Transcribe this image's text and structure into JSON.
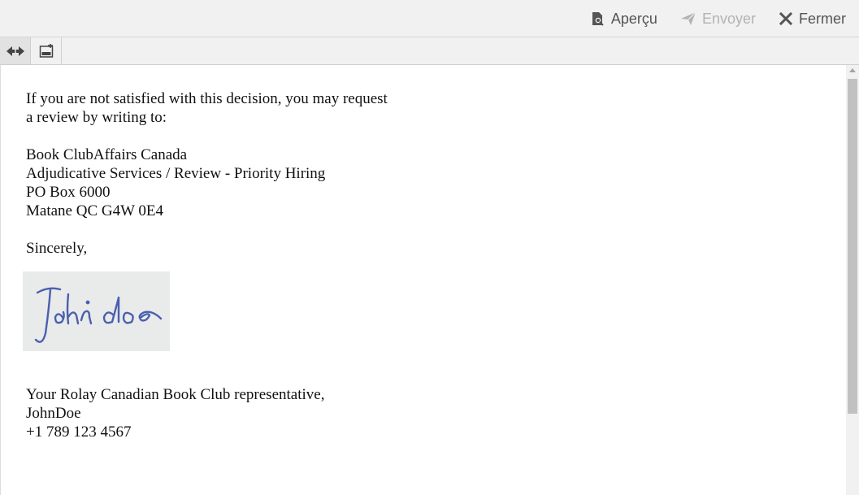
{
  "header": {
    "actions": [
      {
        "label": "Aperçu",
        "icon": "preview-icon",
        "enabled": true
      },
      {
        "label": "Envoyer",
        "icon": "send-icon",
        "enabled": false
      },
      {
        "label": "Fermer",
        "icon": "close-icon",
        "enabled": true
      }
    ]
  },
  "toolbar": {
    "buttons": [
      {
        "icon": "direction-toggle-icon",
        "active": true
      },
      {
        "icon": "insert-field-icon",
        "active": false
      }
    ]
  },
  "letter": {
    "intro_lines": [
      "If you are not satisfied with this decision, you may request",
      "a review by writing to:"
    ],
    "address_lines": [
      "Book ClubAffairs Canada",
      "Adjudicative Services / Review - Priority Hiring",
      "PO Box 6000",
      "Matane QC G4W 0E4"
    ],
    "closing": "Sincerely,",
    "signature_text": "John doe",
    "signature_lines": [
      "Your Rolay Canadian Book Club representative,",
      "JohnDoe",
      "+1 789 123 4567"
    ]
  },
  "colors": {
    "bar_background": "#f1f1f1",
    "action_text": "#555555",
    "action_disabled": "#b3b3b3",
    "signature_ink": "#4a5fae"
  }
}
